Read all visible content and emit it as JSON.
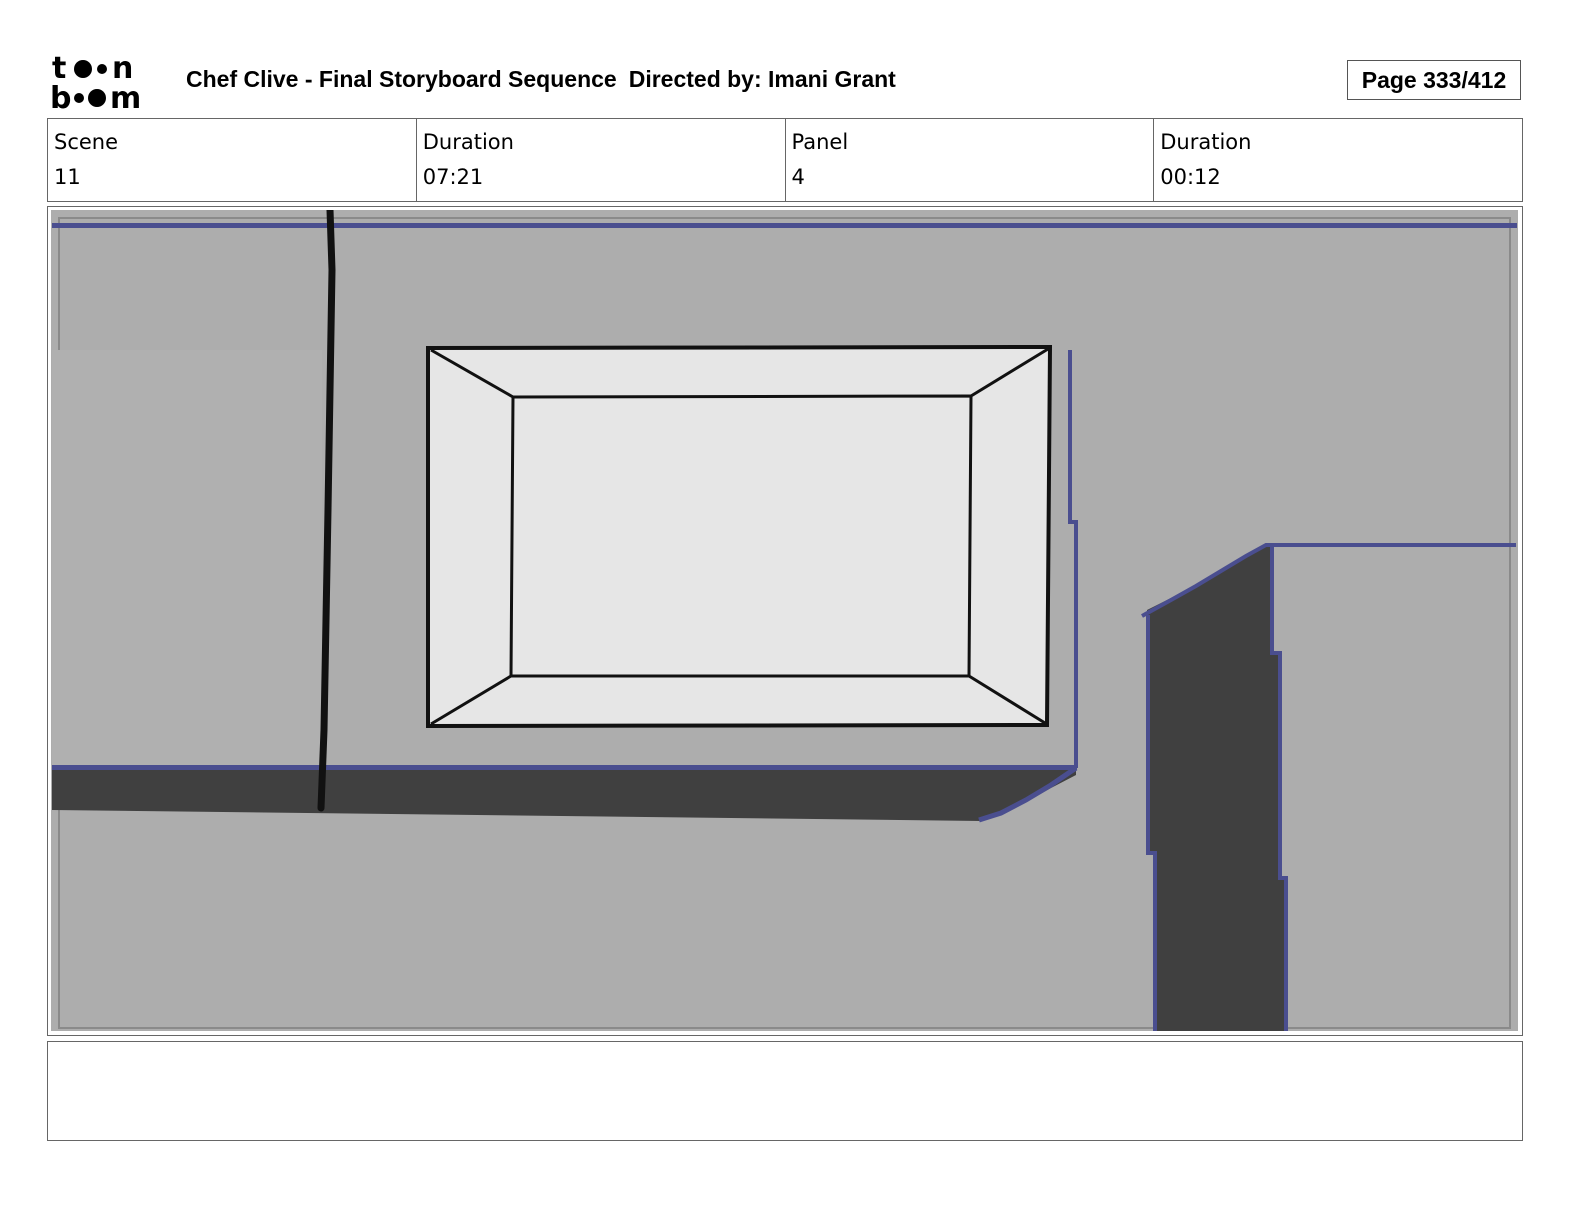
{
  "header": {
    "logo_text": "toon boom",
    "title": "Chef Clive - Final Storyboard Sequence",
    "director": "Directed by: Imani Grant",
    "page": "Page 333/412"
  },
  "info": {
    "scene_label": "Scene",
    "scene_value": "11",
    "scene_duration_label": "Duration",
    "scene_duration_value": "07:21",
    "panel_label": "Panel",
    "panel_value": "4",
    "panel_duration_label": "Duration",
    "panel_duration_value": "00:12"
  },
  "notes": {
    "text": ""
  },
  "colors": {
    "background_gray": "#adadad",
    "shadow_dark": "#404040",
    "line_blue": "#4a4e8f",
    "window_fill": "#e6e6e6"
  }
}
